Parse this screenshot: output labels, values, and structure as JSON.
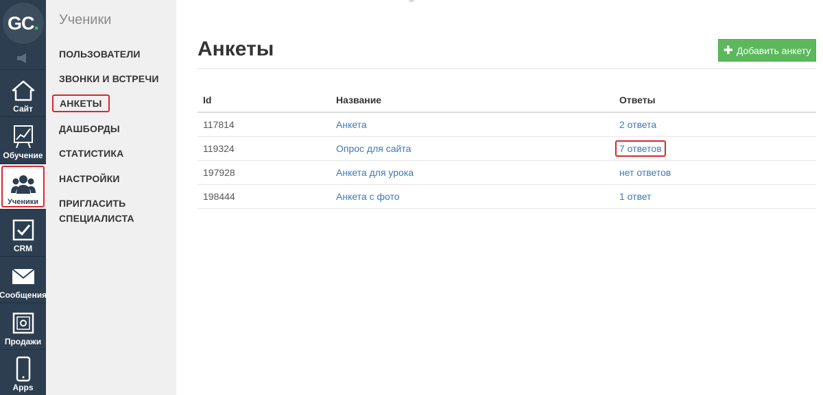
{
  "rail": {
    "logo_text": "GC",
    "logo_dot": ".",
    "items": [
      {
        "label": "Сайт",
        "icon": "home-icon"
      },
      {
        "label": "Обучение",
        "icon": "chart-board-icon"
      },
      {
        "label": "Ученики",
        "icon": "users-icon",
        "active": true
      },
      {
        "label": "CRM",
        "icon": "checkbox-icon"
      },
      {
        "label": "Сообщения",
        "icon": "envelope-icon"
      },
      {
        "label": "Продажи",
        "icon": "safe-icon"
      },
      {
        "label": "Apps",
        "icon": "phone-icon"
      }
    ]
  },
  "sidebar": {
    "heading": "Ученики",
    "items": [
      {
        "label": "ПОЛЬЗОВАТЕЛИ"
      },
      {
        "label": "ЗВОНКИ И ВСТРЕЧИ"
      },
      {
        "label": "АНКЕТЫ",
        "active": true
      },
      {
        "label": "ДАШБОРДЫ"
      },
      {
        "label": "СТАТИСТИКА"
      },
      {
        "label": "НАСТРОЙКИ"
      },
      {
        "label": "ПРИГЛАСИТЬ"
      },
      {
        "label": "СПЕЦИАЛИСТА"
      }
    ]
  },
  "main": {
    "title": "Анкеты",
    "add_button": "Добавить анкету",
    "table": {
      "headers": [
        "Id",
        "Название",
        "Ответы"
      ],
      "rows": [
        {
          "id": "117814",
          "name": "Анкета",
          "answers": "2 ответа"
        },
        {
          "id": "119324",
          "name": "Опрос для сайта",
          "answers": "7 ответов"
        },
        {
          "id": "197928",
          "name": "Анкета для урока",
          "answers": "нет ответов"
        },
        {
          "id": "198444",
          "name": "Анкета с фото",
          "answers": "1 ответ"
        }
      ]
    }
  },
  "colors": {
    "rail_bg": "#2c3e50",
    "sidebar_bg": "#f0f0f0",
    "link": "#3d78b8",
    "button_green": "#5cb85c",
    "highlight_red": "#d9262c",
    "logo_accent": "#2ecc71"
  }
}
